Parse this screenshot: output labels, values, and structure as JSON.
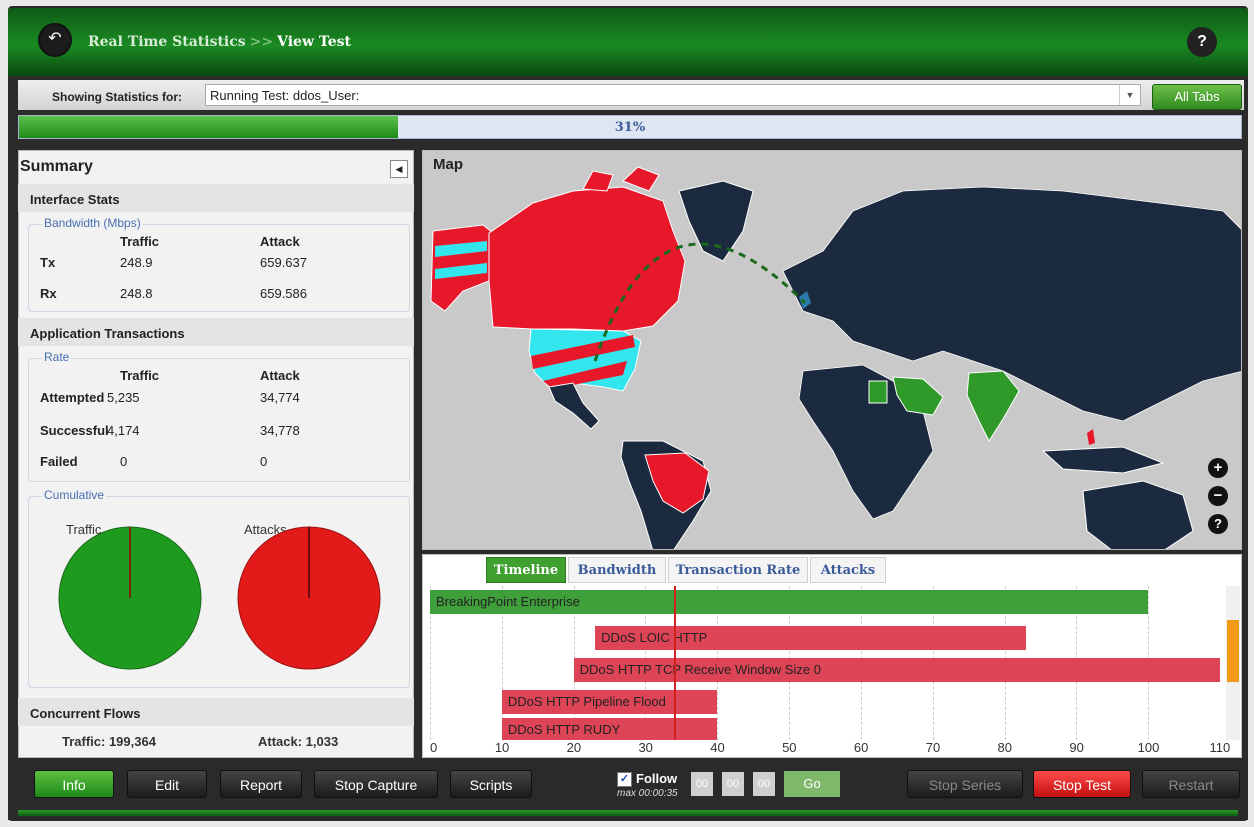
{
  "header": {
    "back_icon": "back-arrow-icon",
    "crumb_parent": "Real Time Statistics",
    "crumb_sep": ">>",
    "crumb_current": "View Test",
    "help": "?"
  },
  "showing": {
    "label": "Showing Statistics for:",
    "value": "Running Test: ddos_User:",
    "all_tabs": "All Tabs"
  },
  "progress": {
    "percent_text": "31%",
    "fraction": 0.31
  },
  "summary": {
    "title": "Summary",
    "interface_stats": {
      "title": "Interface Stats",
      "group": "Bandwidth (Mbps)",
      "col_traffic": "Traffic",
      "col_attack": "Attack",
      "rows": [
        {
          "label": "Tx",
          "traffic": "248.9",
          "attack": "659.637"
        },
        {
          "label": "Rx",
          "traffic": "248.8",
          "attack": "659.586"
        }
      ]
    },
    "app_transactions": {
      "title": "Application Transactions",
      "group": "Rate",
      "col_traffic": "Traffic",
      "col_attack": "Attack",
      "rows": [
        {
          "label": "Attempted",
          "traffic": "5,235",
          "attack": "34,774"
        },
        {
          "label": "Successful",
          "traffic": "4,174",
          "attack": "34,778"
        },
        {
          "label": "Failed",
          "traffic": "0",
          "attack": "0"
        }
      ]
    },
    "cumulative": {
      "group": "Cumulative",
      "traffic_label": "Traffic",
      "attacks_label": "Attacks",
      "traffic_color": "#1e9a1e",
      "attacks_color": "#e31a1a"
    },
    "concurrent": {
      "title": "Concurrent Flows",
      "traffic": "Traffic: 199,364",
      "attack": "Attack: 1,033"
    }
  },
  "map": {
    "title": "Map",
    "zoom_in": "+",
    "zoom_out": "−",
    "help": "?"
  },
  "timeline": {
    "tabs": [
      "Timeline",
      "Bandwidth",
      "Transaction Rate",
      "Attacks"
    ],
    "active_tab": "Timeline",
    "axis_ticks": [
      "0",
      "10",
      "20",
      "30",
      "40",
      "50",
      "60",
      "70",
      "80",
      "90",
      "100",
      "110"
    ],
    "cursor": 34,
    "bars": [
      {
        "name": "BreakingPoint Enterprise",
        "start": 0,
        "end": 100,
        "color": "green"
      },
      {
        "name": "DDoS LOIC HTTP",
        "start": 23,
        "end": 83,
        "color": "red"
      },
      {
        "name": "DDoS HTTP TCP Receive Window Size 0",
        "start": 20,
        "end": 110,
        "color": "red"
      },
      {
        "name": "DDoS HTTP Pipeline Flood",
        "start": 10,
        "end": 40,
        "color": "red"
      },
      {
        "name": "DDoS HTTP RUDY",
        "start": 10,
        "end": 40,
        "color": "red"
      }
    ]
  },
  "toolbar": {
    "info": "Info",
    "edit": "Edit",
    "report": "Report",
    "stop_capture": "Stop Capture",
    "scripts": "Scripts",
    "follow": "Follow",
    "max": "max 00:00:35",
    "t1": "00",
    "t2": "00",
    "t3": "00",
    "go": "Go",
    "stop_series": "Stop Series",
    "stop_test": "Stop Test",
    "restart": "Restart"
  }
}
